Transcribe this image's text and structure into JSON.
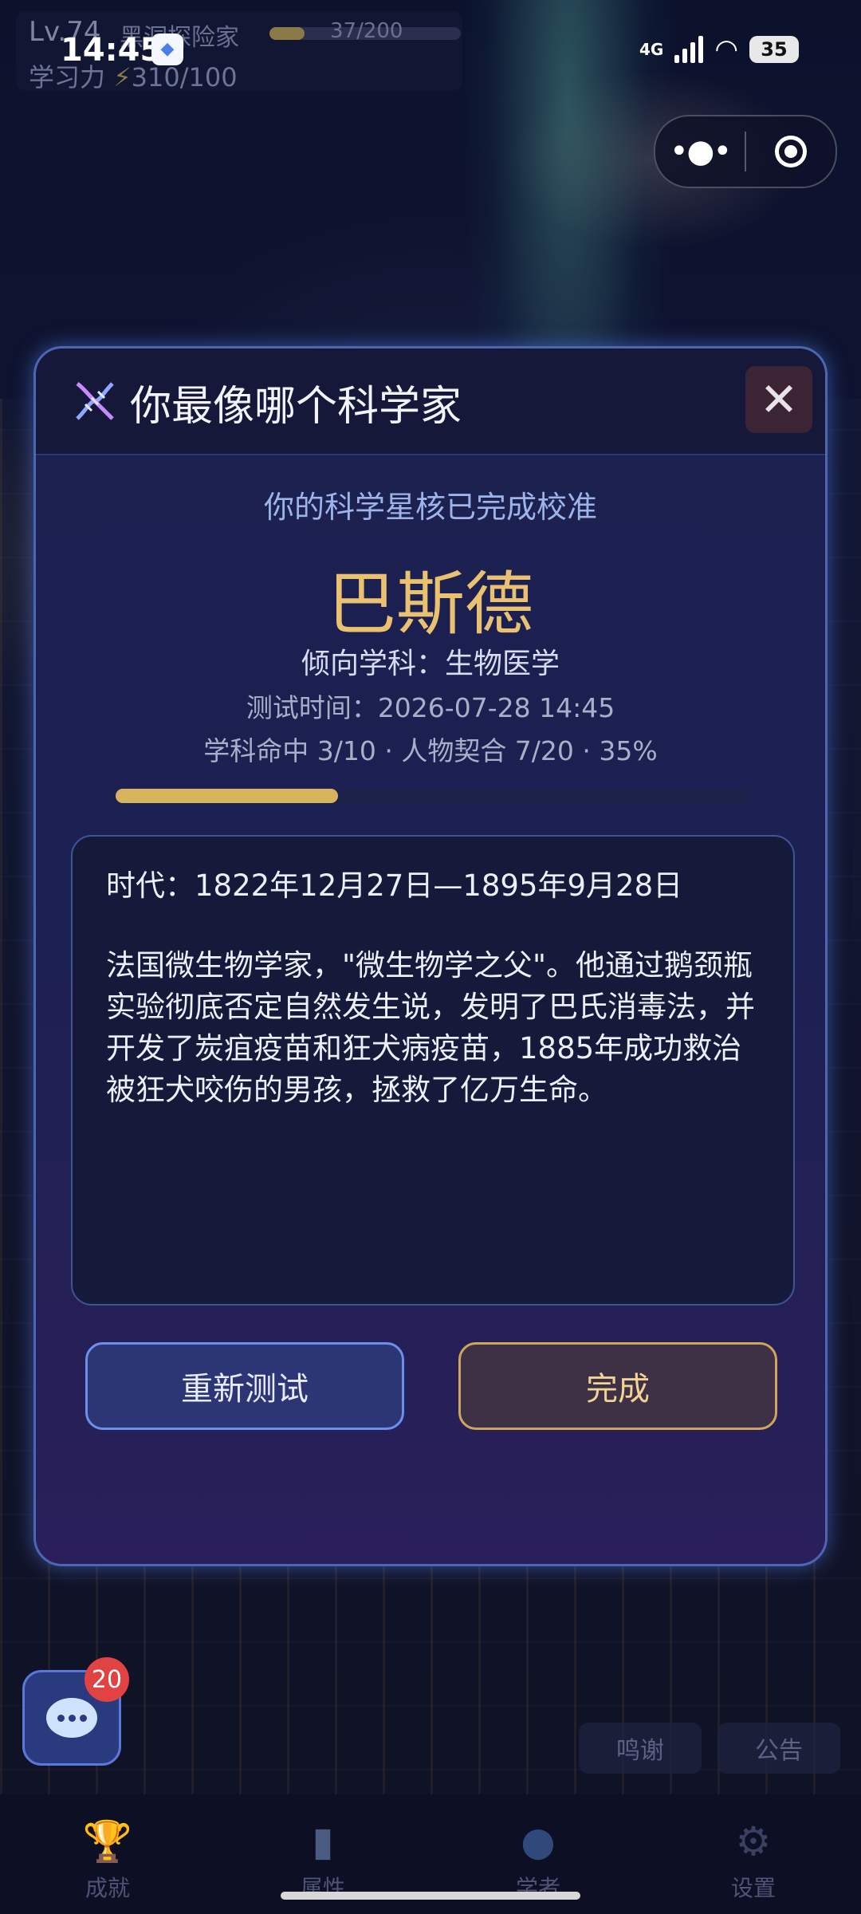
{
  "status_bar": {
    "time": "14:45",
    "network": "4G",
    "battery": "35"
  },
  "player": {
    "level": "Lv.74",
    "title": "黑洞探险家",
    "xp_text": "37/200",
    "xp_fraction": 0.185,
    "study_label": "学习力",
    "study_value": "310/100"
  },
  "modal": {
    "title": "你最像哪个科学家",
    "subtitle": "你的科学星核已完成校准",
    "scientist": "巴斯德",
    "field": "倾向学科：生物医学",
    "test_time": "测试时间：2026-07-28 14:45",
    "stats": "学科命中 3/10 · 人物契合 7/20 · 35%",
    "progress": 0.35,
    "era": "时代：1822年12月27日—1895年9月28日",
    "bio": "法国微生物学家，\"微生物学之父\"。他通过鹅颈瓶实验彻底否定自然发生说，发明了巴氏消毒法，并开发了炭疽疫苗和狂犬病疫苗，1885年成功救治被狂犬咬伤的男孩，拯救了亿万生命。",
    "retry_label": "重新测试",
    "done_label": "完成"
  },
  "chat": {
    "badge": "20"
  },
  "footer_buttons": {
    "thanks": "鸣谢",
    "notice": "公告"
  },
  "tabs": [
    {
      "label": "成就",
      "icon": "trophy-icon"
    },
    {
      "label": "属性",
      "icon": "chart-icon"
    },
    {
      "label": "学者",
      "icon": "person-icon"
    },
    {
      "label": "设置",
      "icon": "gear-icon"
    }
  ],
  "colors": {
    "accent_gold": "#e9c170",
    "accent_blue": "#6b8fea",
    "badge_red": "#e14242"
  }
}
